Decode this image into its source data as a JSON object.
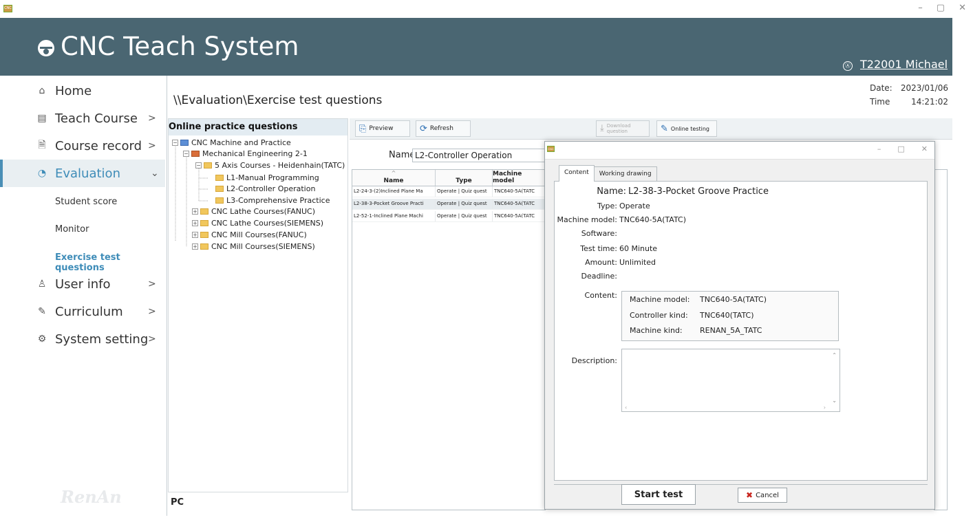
{
  "window": {
    "app_icon": "CNC",
    "controls": [
      "–",
      "▢",
      "✕"
    ]
  },
  "header": {
    "title": "CNC Teach System",
    "user": "T22001 Michael",
    "user_icon": "Ⓐ"
  },
  "sidebar": {
    "items": [
      {
        "label": "Home",
        "icon": "⌂"
      },
      {
        "label": "Teach Course",
        "icon": "▤",
        "chevron": ">"
      },
      {
        "label": "Course record",
        "icon": "🗎",
        "chevron": ">"
      },
      {
        "label": "Evaluation",
        "icon": "◔",
        "chevron": "⌄"
      },
      {
        "label": "User info",
        "icon": "♙",
        "chevron": ">"
      },
      {
        "label": "Curriculum",
        "icon": "✎",
        "chevron": ">"
      },
      {
        "label": "System setting",
        "icon": "⚙",
        "chevron": ">"
      }
    ],
    "sub_items": [
      "Student score",
      "Monitor",
      "Exercise test questions"
    ],
    "brand": "RenAn"
  },
  "breadcrumb": "\\\\Evaluation\\Exercise test questions",
  "datetime": {
    "date_label": "Date:",
    "date": "2023/01/06",
    "time_label": "Time",
    "time": "14:21:02"
  },
  "tree": {
    "header": "Online practice questions",
    "nodes": [
      "CNC Machine and Practice",
      "Mechanical Engineering 2-1",
      "5 Axis Courses - Heidenhain(TATC)",
      "L1-Manual Programming",
      "L2-Controller Operation",
      "L3-Comprehensive Practice",
      "CNC Lathe Courses(FANUC)",
      "CNC Lathe Courses(SIEMENS)",
      "CNC Mill Courses(FANUC)",
      "CNC Mill Courses(SIEMENS)"
    ],
    "footer": "PC"
  },
  "toolbar": {
    "preview": "Preview",
    "refresh": "Refresh",
    "download": "Download question",
    "online": "Online testing"
  },
  "filter": {
    "name_label": "Name:",
    "name_value": "L2-Controller Operation"
  },
  "grid": {
    "columns": [
      "Name",
      "Type",
      "Machine model"
    ],
    "sort_indicator": "^",
    "rows": [
      [
        "L2-24-3-(2)Inclined Plane Ma",
        "Operate | Quiz quest",
        "TNC640-5A(TATC"
      ],
      [
        "L2-38-3-Pocket Groove Practi",
        "Operate | Quiz quest",
        "TNC640-5A(TATC"
      ],
      [
        "L2-52-1-Inclined Plane Machi",
        "Operate | Quiz quest",
        "TNC640-5A(TATC"
      ]
    ]
  },
  "dialog": {
    "icon": "CNC",
    "controls": [
      "–",
      "□",
      "✕"
    ],
    "tabs": [
      "Content",
      "Working drawing"
    ],
    "fields": {
      "name_label": "Name:",
      "name": "L2-38-3-Pocket Groove Practice",
      "type_label": "Type:",
      "type": "Operate",
      "machine_label": "Machine model:",
      "machine": "TNC640-5A(TATC)",
      "software_label": "Software:",
      "software": "",
      "test_time_label": "Test time:",
      "test_time": "60 Minute",
      "amount_label": "Amount:",
      "amount": "Unlimited",
      "deadline_label": "Deadline:",
      "deadline": "",
      "content_label": "Content:",
      "description_label": "Description:"
    },
    "content_box": {
      "machine_model_label": "Machine model:",
      "machine_model": "TNC640-5A(TATC)",
      "controller_kind_label": "Controller kind:",
      "controller_kind": "TNC640(TATC)",
      "machine_kind_label": "Machine kind:",
      "machine_kind": "RENAN_5A_TATC"
    },
    "start_label": "Start test",
    "cancel_label": "Cancel"
  }
}
